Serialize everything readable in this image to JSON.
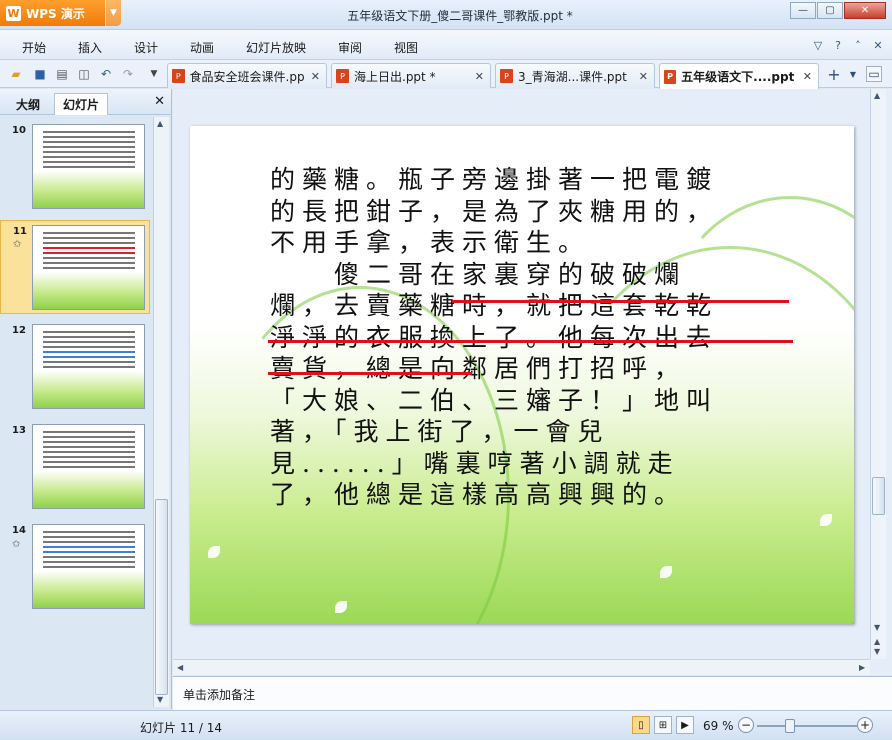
{
  "app": {
    "name": "WPS 演示",
    "window_title": "五年级语文下册_傻二哥课件_鄂教版.ppt *"
  },
  "menu": [
    "开始",
    "插入",
    "设计",
    "动画",
    "幻灯片放映",
    "审阅",
    "视图"
  ],
  "tabs": [
    {
      "label": "食品安全班会课件.ppt",
      "active": false
    },
    {
      "label": "海上日出.ppt *",
      "active": false
    },
    {
      "label": "3_青海湖...课件.ppt",
      "active": false
    },
    {
      "label": "五年级语文下....ppt *",
      "active": true
    }
  ],
  "sidebar": {
    "tabs": [
      "大纲",
      "幻灯片"
    ],
    "active_tab": "幻灯片",
    "thumbnails": [
      {
        "number": "10",
        "star": false,
        "selected": false
      },
      {
        "number": "11",
        "star": true,
        "selected": true
      },
      {
        "number": "12",
        "star": false,
        "selected": false
      },
      {
        "number": "13",
        "star": false,
        "selected": false
      },
      {
        "number": "14",
        "star": true,
        "selected": false
      }
    ]
  },
  "slide": {
    "lines": [
      "的藥糖。瓶子旁邊掛著一把電鍍",
      "的長把鉗子，是為了夾糖用的，",
      "不用手拿，表示衛生。",
      "　　傻二哥在家裏穿的破破爛",
      "爛，去賣藥糖時，就把這套乾乾",
      "淨淨的衣服換上了。他每次出去",
      "賣貨，總是向鄰居們打招呼，",
      "「大娘、二伯、三嬸子！」地叫",
      "著，「我上街了，一會兒",
      "見......」嘴裏哼著小調就走",
      "了，他總是這樣高高興興的。"
    ]
  },
  "notes_placeholder": "单击添加备注",
  "status": {
    "slide_indicator": "幻灯片 11 / 14",
    "zoom": "69 %"
  },
  "colors": {
    "accent_orange": "#f07b0a",
    "strike_red": "#e01018",
    "selected_thumb": "#fbe29a"
  }
}
